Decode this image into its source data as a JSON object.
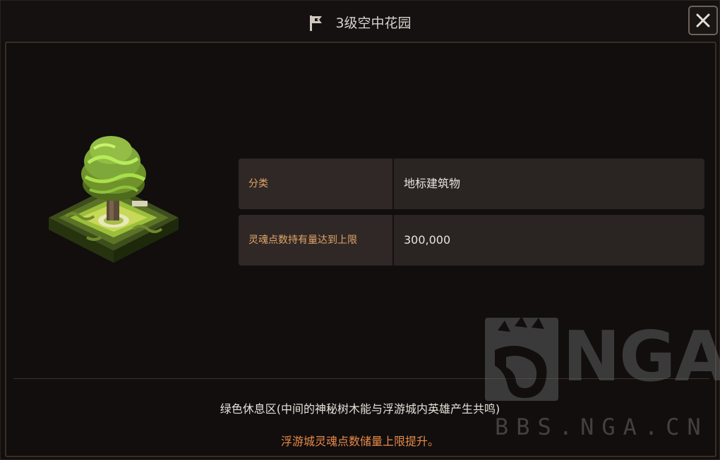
{
  "window": {
    "title": "3级空中花园",
    "icons": {
      "title": "flag-icon",
      "close": "close-icon"
    }
  },
  "info": {
    "rows": [
      {
        "label": "分类",
        "value": "地标建筑物"
      },
      {
        "label": "灵魂点数持有量达到上限",
        "value": "300,000"
      }
    ]
  },
  "description": "绿色休息区(中间的神秘树木能与浮游城内英雄产生共鸣)",
  "effect": "浮游城灵魂点数储量上限提升。",
  "watermark": {
    "logo": "NGA",
    "url": "BBS.NGA.CN"
  },
  "colors": {
    "label": "#e2a567",
    "effect": "#e8894a",
    "foliage": "#7fa83a"
  }
}
